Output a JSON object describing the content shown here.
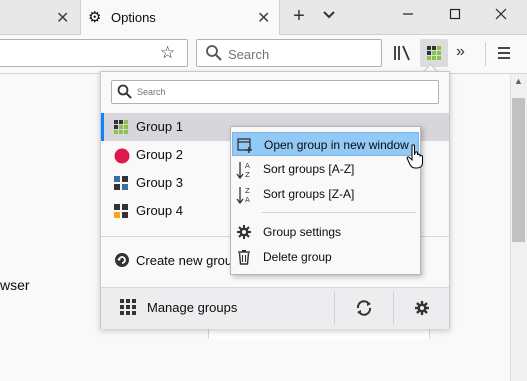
{
  "tabs": [
    {
      "label": "",
      "active": false
    },
    {
      "label": "Options",
      "active": true,
      "icon": "gear-icon"
    }
  ],
  "toolbar": {
    "search_placeholder": "Search",
    "new_tab": "+",
    "tab_list": "⌄",
    "overflow": "»"
  },
  "window_controls": {
    "minimize": "—",
    "maximize": "☐",
    "close": "✕"
  },
  "page": {
    "partial_text": "wser"
  },
  "panel": {
    "search_placeholder": "Search",
    "groups": [
      {
        "label": "Group 1",
        "icon": "grid-green-icon",
        "selected": true
      },
      {
        "label": "Group 2",
        "icon": "red-dot-icon",
        "selected": false
      },
      {
        "label": "Group 3",
        "icon": "grid-blue-icon",
        "selected": false
      },
      {
        "label": "Group 4",
        "icon": "grid-orange-icon",
        "selected": false
      }
    ],
    "create_label": "Create new group",
    "manage_label": "Manage groups"
  },
  "context_menu": {
    "items": [
      {
        "label": "Open group in new window",
        "icon": "new-window-icon",
        "highlighted": true
      },
      {
        "label": "Sort groups [A-Z]",
        "icon": "sort-az-icon"
      },
      {
        "label": "Sort groups [Z-A]",
        "icon": "sort-za-icon"
      },
      {
        "label": "Group settings",
        "icon": "gear-icon"
      },
      {
        "label": "Delete group",
        "icon": "trash-icon"
      }
    ]
  },
  "colors": {
    "accent": "#0a84ff",
    "highlight": "#91c9f7",
    "group2": "#e0194b"
  }
}
